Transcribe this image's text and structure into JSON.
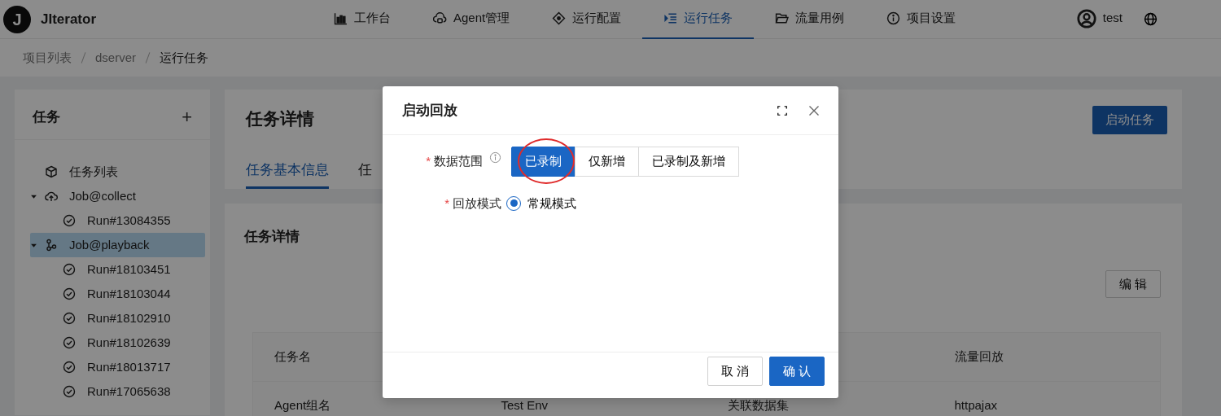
{
  "app": {
    "logo_letter": "J",
    "name": "JIterator"
  },
  "nav": [
    {
      "label": "工作台",
      "selected": false
    },
    {
      "label": "Agent管理",
      "selected": false
    },
    {
      "label": "运行配置",
      "selected": false
    },
    {
      "label": "运行任务",
      "selected": true
    },
    {
      "label": "流量用例",
      "selected": false
    },
    {
      "label": "项目设置",
      "selected": false
    }
  ],
  "user": {
    "name": "test"
  },
  "breadcrumb": [
    "项目列表",
    "dserver",
    "运行任务"
  ],
  "sidebar": {
    "title": "任务",
    "add": "+",
    "items": [
      {
        "label": "任务列表",
        "kind": "list",
        "selected": false
      },
      {
        "label": "Job@collect",
        "kind": "collect",
        "selected": false,
        "expanded": true,
        "children": [
          {
            "label": "Run#13084355",
            "kind": "run",
            "selected": false
          }
        ]
      },
      {
        "label": "Job@playback",
        "kind": "playback",
        "selected": true,
        "expanded": true,
        "children": [
          {
            "label": "Run#18103451",
            "kind": "run",
            "selected": false
          },
          {
            "label": "Run#18103044",
            "kind": "run",
            "selected": false
          },
          {
            "label": "Run#18102910",
            "kind": "run",
            "selected": false
          },
          {
            "label": "Run#18102639",
            "kind": "run",
            "selected": false
          },
          {
            "label": "Run#18013717",
            "kind": "run",
            "selected": false
          },
          {
            "label": "Run#17065638",
            "kind": "run",
            "selected": false
          }
        ]
      }
    ]
  },
  "header": {
    "title": "任务详情",
    "action": "启动任务",
    "tabs": [
      {
        "label": "任务基本信息",
        "selected": true
      },
      {
        "label": "任",
        "selected": false
      }
    ]
  },
  "details": {
    "title": "任务详情",
    "edit": "编 辑",
    "rows": [
      {
        "column_1": "任务名",
        "column_4": "流量回放"
      },
      {
        "column_1": "Agent组名",
        "column_2": "Test Env",
        "column_3": "关联数据集",
        "column_4": "httpajax"
      }
    ]
  },
  "dialog": {
    "title": "启动回放",
    "fields": [
      {
        "label": "数据范围",
        "required_mark": "*",
        "info": true,
        "kind": "segmented",
        "options": [
          {
            "label": "已录制",
            "selected": true,
            "marked": true
          },
          {
            "label": "仅新增",
            "selected": false,
            "marked": false
          },
          {
            "label": "已录制及新增",
            "selected": false,
            "marked": false
          }
        ]
      },
      {
        "label": "回放模式",
        "required_mark": "*",
        "kind": "radio",
        "options": [
          {
            "label": "常规模式",
            "selected": true
          }
        ]
      }
    ],
    "buttons": [
      {
        "label": "取 消",
        "kind": "secondary"
      },
      {
        "label": "确 认",
        "kind": "primary"
      }
    ]
  }
}
